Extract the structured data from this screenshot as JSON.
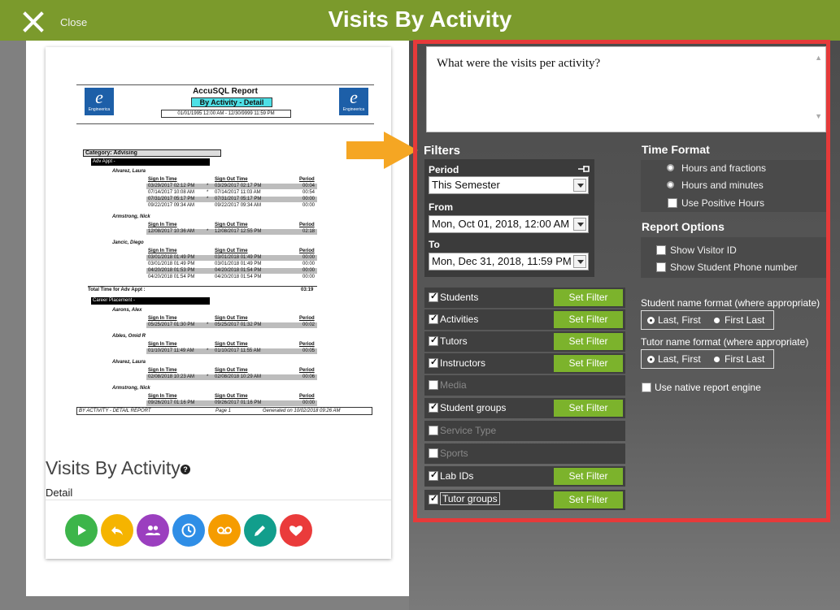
{
  "header": {
    "close_label": "Close",
    "title": "Visits By Activity"
  },
  "preview": {
    "report": {
      "title": "AccuSQL Report",
      "subtitle": "By Activity - Detail",
      "date_range": "01/01/1995 12:00 AM  -  12/30/9999 11:59 PM",
      "logo_letter": "e",
      "logo_text": "Engineerica",
      "category": "Category:  Advising",
      "groups": [
        {
          "label": "Adv Appt -",
          "people": [
            {
              "name": "Alvarez, Laura",
              "rows": [
                {
                  "in": "03/29/2017 02:12 PM",
                  "out": "03/29/2017 02:17 PM",
                  "flag": "*",
                  "period": "00:04"
                },
                {
                  "in": "07/14/2017 10:08 AM",
                  "out": "07/14/2017 11:03 AM",
                  "flag": "*",
                  "period": "00:54"
                },
                {
                  "in": "07/31/2017 05:17 PM",
                  "out": "07/31/2017 05:17 PM",
                  "flag": "*",
                  "period": "00:00"
                },
                {
                  "in": "09/22/2017 09:34 AM",
                  "out": "09/22/2017 09:34 AM",
                  "flag": "",
                  "period": "00:00"
                }
              ]
            },
            {
              "name": "Armstrong, Nick",
              "rows": [
                {
                  "in": "12/08/2017 10:36 AM",
                  "out": "12/08/2017 12:55 PM",
                  "flag": "*",
                  "period": "02:18"
                }
              ]
            },
            {
              "name": "Jancic, Diego",
              "rows": [
                {
                  "in": "03/01/2018 01:49 PM",
                  "out": "03/01/2018 01:49 PM",
                  "flag": "",
                  "period": "00:00"
                },
                {
                  "in": "03/01/2018 01:49 PM",
                  "out": "03/01/2018 01:49 PM",
                  "flag": "",
                  "period": "00:00"
                },
                {
                  "in": "04/20/2018 01:53 PM",
                  "out": "04/20/2018 01:54 PM",
                  "flag": "",
                  "period": "00:00"
                },
                {
                  "in": "04/20/2018 01:54 PM",
                  "out": "04/20/2018 01:54 PM",
                  "flag": "",
                  "period": "00:00"
                }
              ]
            }
          ],
          "total_label": "Total Time for Adv Appt :",
          "total": "03:19"
        },
        {
          "label": "Career Placement -",
          "people": [
            {
              "name": "Aarons, Alex",
              "rows": [
                {
                  "in": "05/25/2017 01:30 PM",
                  "out": "05/25/2017 01:32 PM",
                  "flag": "*",
                  "period": "00:02"
                }
              ]
            },
            {
              "name": "Ables, Omid R",
              "rows": [
                {
                  "in": "01/10/2017 11:49 AM",
                  "out": "01/10/2017 11:55 AM",
                  "flag": "*",
                  "period": "00:05"
                }
              ]
            },
            {
              "name": "Alvarez, Laura",
              "rows": [
                {
                  "in": "02/08/2018 10:23 AM",
                  "out": "02/08/2018 10:29 AM",
                  "flag": "*",
                  "period": "00:06"
                }
              ]
            },
            {
              "name": "Armstrong, Nick",
              "rows": [
                {
                  "in": "09/26/2017 01:16 PM",
                  "out": "09/26/2017 01:16 PM",
                  "flag": "",
                  "period": "00:00"
                }
              ]
            }
          ]
        }
      ],
      "col_in": "Sign In Time",
      "col_out": "Sign Out Time",
      "col_period": "Period",
      "footer_left": "BY ACTIVITY - DETAIL REPORT",
      "footer_mid": "Page 1",
      "footer_right": "Generated on 10/02/2018 09:26 AM"
    },
    "title": "Visits By Activity",
    "help": "?",
    "subtitle": "Detail",
    "action_buttons": [
      {
        "name": "play-button",
        "icon": "play-icon",
        "color": "#3db54a"
      },
      {
        "name": "reply-button",
        "icon": "reply-icon",
        "color": "#f5b400"
      },
      {
        "name": "people-button",
        "icon": "people-icon",
        "color": "#9b3fbf"
      },
      {
        "name": "clock-button",
        "icon": "clock-icon",
        "color": "#2f8ee6"
      },
      {
        "name": "voicemail-button",
        "icon": "voicemail-icon",
        "color": "#f59c00"
      },
      {
        "name": "edit-button",
        "icon": "pencil-icon",
        "color": "#129e8c"
      },
      {
        "name": "favorite-button",
        "icon": "heart-icon",
        "color": "#ea3b3b"
      }
    ]
  },
  "question": "What were the visits per activity?",
  "filters": {
    "heading": "Filters",
    "period_label": "Period",
    "period_value": "This Semester",
    "from_label": "From",
    "from_value": "Mon,  Oct 01, 2018, 12:00 AM",
    "to_label": "To",
    "to_value": "Mon, Dec 31, 2018, 11:59 PM",
    "set_filter_label": "Set Filter",
    "items": [
      {
        "label": "Students",
        "checked": true,
        "enabled": true
      },
      {
        "label": "Activities",
        "checked": true,
        "enabled": true
      },
      {
        "label": "Tutors",
        "checked": true,
        "enabled": true
      },
      {
        "label": "Instructors",
        "checked": true,
        "enabled": true
      },
      {
        "label": "Media",
        "checked": false,
        "enabled": false
      },
      {
        "label": "Student groups",
        "checked": true,
        "enabled": true
      },
      {
        "label": "Service Type",
        "checked": false,
        "enabled": false
      },
      {
        "label": "Sports",
        "checked": false,
        "enabled": false
      },
      {
        "label": "Lab IDs",
        "checked": true,
        "enabled": true
      },
      {
        "label": "Tutor groups",
        "checked": true,
        "enabled": true
      }
    ]
  },
  "time_format": {
    "heading": "Time Format",
    "options": [
      "Hours and fractions",
      "Hours and minutes"
    ],
    "positive_hours": "Use Positive Hours"
  },
  "report_options": {
    "heading": "Report Options",
    "options": [
      "Show Visitor ID",
      "Show Student Phone number"
    ],
    "student_format_label": "Student name format (where appropriate)",
    "tutor_format_label": "Tutor name format (where appropriate)",
    "format_options": [
      "Last, First",
      "First Last"
    ],
    "native_engine": "Use native report engine"
  }
}
